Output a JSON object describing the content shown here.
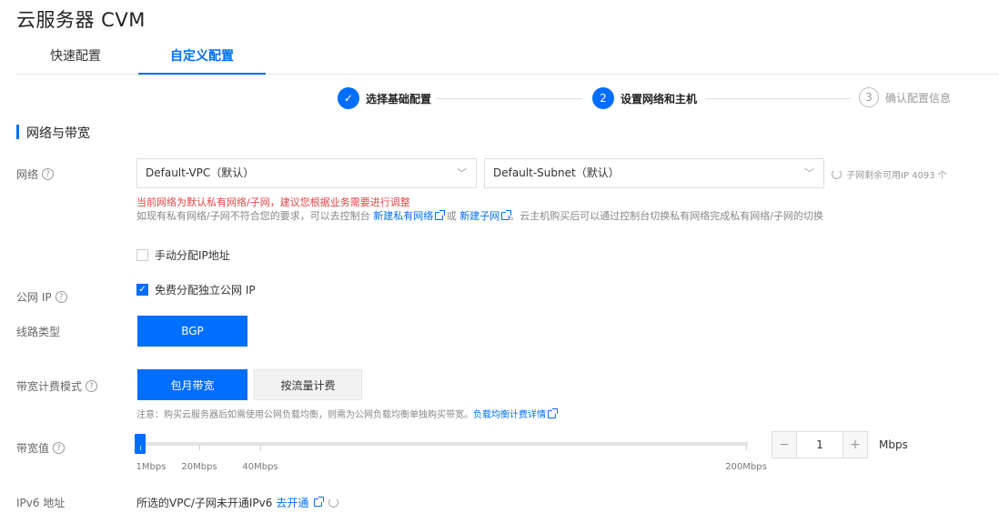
{
  "app": {
    "title": "云服务器 CVM"
  },
  "tabs": [
    {
      "label": "快速配置",
      "active": false
    },
    {
      "label": "自定义配置",
      "active": true
    }
  ],
  "steps": [
    {
      "label": "选择基础配置",
      "state": "done",
      "marker": "✓"
    },
    {
      "label": "设置网络和主机",
      "state": "current",
      "marker": "2"
    },
    {
      "label": "确认配置信息",
      "state": "todo",
      "marker": "3"
    }
  ],
  "section": {
    "title": "网络与带宽"
  },
  "network": {
    "label": "网络",
    "vpc_value": "Default-VPC（默认）",
    "subnet_value": "Default-Subnet（默认）",
    "available_ip": "子网剩余可用IP 4093 个",
    "warning": "当前网络为默认私有网络/子网，建议您根据业务需要进行调整",
    "hint_prefix": "如现有私有网络/子网不符合您的要求，可以去控制台",
    "link_new_vpc": "新建私有网络",
    "hint_or": "或",
    "link_new_subnet": "新建子网",
    "hint_suffix": "。云主机购买后可以通过控制台切换私有网络完成私有网络/子网的切换",
    "manual_ip_label": "手动分配IP地址",
    "manual_ip_checked": false
  },
  "public_ip": {
    "label": "公网 IP",
    "checkbox_label": "免费分配独立公网 IP",
    "checked": true
  },
  "line_type": {
    "label": "线路类型",
    "value": "BGP"
  },
  "billing": {
    "label": "带宽计费模式",
    "options": [
      "包月带宽",
      "按流量计费"
    ],
    "selected": "包月带宽",
    "note_prefix": "注意：购买云服务器后如需使用公网负载均衡，则需为公网负载均衡单独购买带宽。",
    "note_link": "负载均衡计费详情"
  },
  "bandwidth": {
    "label": "带宽值",
    "ticks": [
      "1Mbps",
      "20Mbps",
      "40Mbps",
      "200Mbps"
    ],
    "value": "1",
    "min_label": "−",
    "plus_label": "+",
    "unit": "Mbps"
  },
  "ipv6": {
    "label": "IPv6 地址",
    "text": "所选的VPC/子网未开通IPv6",
    "link": "去开通"
  },
  "colors": {
    "accent": "#006eff",
    "warning": "#e54545"
  }
}
